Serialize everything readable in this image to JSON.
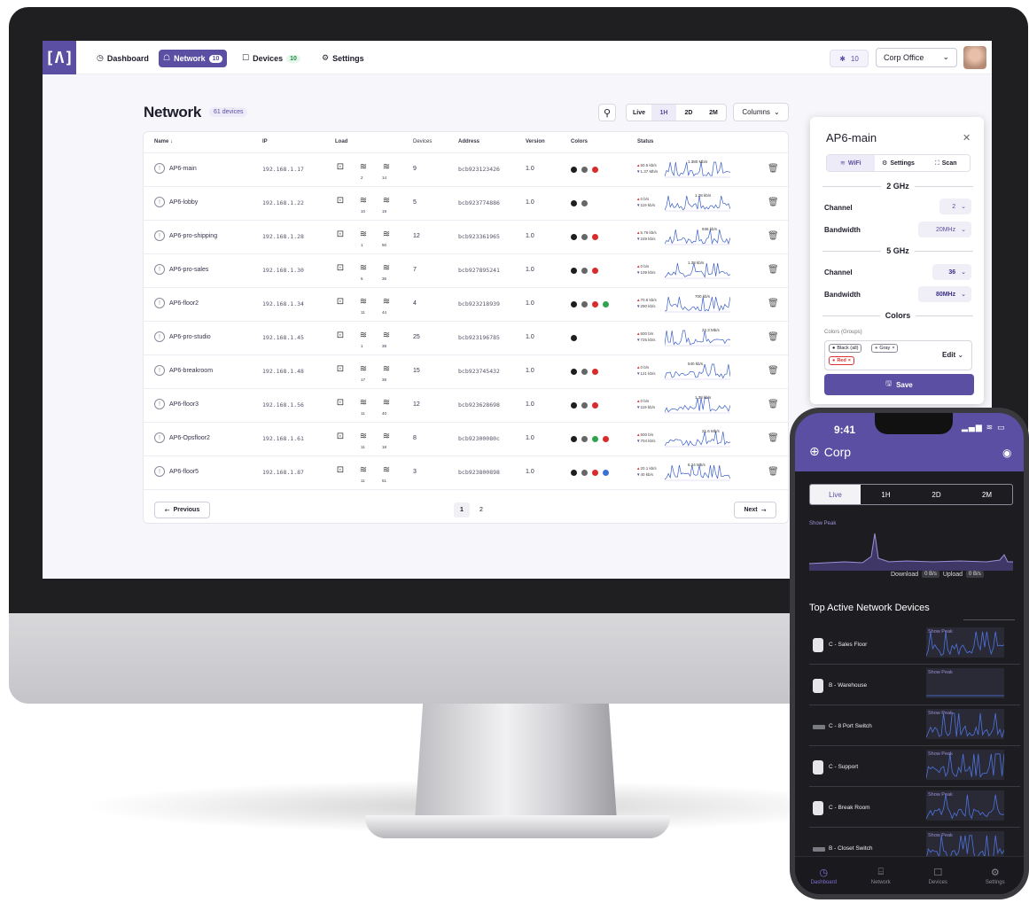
{
  "nav": {
    "logo": "[Λ]",
    "items": [
      {
        "label": "Dashboard",
        "icon": "◷",
        "badge": null,
        "active": false
      },
      {
        "label": "Network",
        "icon": "☖",
        "badge": "10",
        "active": true
      },
      {
        "label": "Devices",
        "icon": "☐",
        "badge": "10",
        "active": false
      },
      {
        "label": "Settings",
        "icon": "⚙",
        "badge": null,
        "active": false
      }
    ],
    "notifications_count": "10",
    "site": "Corp Office"
  },
  "page": {
    "title": "Network",
    "device_count": "61 devices",
    "ranges": [
      "Live",
      "1H",
      "2D",
      "2M"
    ],
    "active_range": "1H",
    "columns_label": "Columns"
  },
  "table": {
    "headers": {
      "name": "Name ↓",
      "ip": "IP",
      "load": "Load",
      "devices": "Devices",
      "address": "Address",
      "version": "Version",
      "colors": "Colors",
      "status": "Status"
    },
    "rows": [
      {
        "name": "AP6-main",
        "ip": "192.168.1.17",
        "devices": "9",
        "address": "bcb923123426",
        "version": "1.0",
        "colors": [
          "#1e1e1e",
          "#666666",
          "#d92b2b"
        ],
        "up": "50.5 kb/s",
        "down": "1.37 Mb/s",
        "peak": "1.380 Mb/s",
        "load2": "2",
        "load3": "14"
      },
      {
        "name": "AP6-lobby",
        "ip": "192.168.1.22",
        "devices": "5",
        "address": "bcb923774886",
        "version": "1.0",
        "colors": [
          "#1e1e1e",
          "#666666"
        ],
        "up": "0 b/s",
        "down": "119 kb/s",
        "peak": "1.28 kb/s",
        "load2": "10",
        "load3": "19"
      },
      {
        "name": "AP6-pro-shipping",
        "ip": "192.168.1.28",
        "devices": "12",
        "address": "bcb923361965",
        "version": "1.0",
        "colors": [
          "#1e1e1e",
          "#666666",
          "#d92b2b"
        ],
        "up": "5.76 kb/s",
        "down": "249 kb/s",
        "peak": "936 kb/s",
        "load2": "1",
        "load3": "50"
      },
      {
        "name": "AP6-pro-sales",
        "ip": "192.168.1.30",
        "devices": "7",
        "address": "bcb927895241",
        "version": "1.0",
        "colors": [
          "#1e1e1e",
          "#666666",
          "#d92b2b"
        ],
        "up": "0 b/s",
        "down": "109 kb/s",
        "peak": "1.38 kb/s",
        "load2": "5",
        "load3": "36"
      },
      {
        "name": "AP6-floor2",
        "ip": "192.168.1.34",
        "devices": "4",
        "address": "bcb923218939",
        "version": "1.0",
        "colors": [
          "#1e1e1e",
          "#666666",
          "#d92b2b",
          "#2ea44f"
        ],
        "up": "70.6 kb/s",
        "down": "290 kb/s",
        "peak": "700 kb/s",
        "load2": "11",
        "load3": "44"
      },
      {
        "name": "AP6-pro-studio",
        "ip": "192.168.1.45",
        "devices": "25",
        "address": "bcb923196785",
        "version": "1.0",
        "colors": [
          "#1e1e1e"
        ],
        "up": "600 b/s",
        "down": "725 kb/s",
        "peak": "22.3 Mb/s",
        "load2": "1",
        "load3": "38"
      },
      {
        "name": "AP6-breakroom",
        "ip": "192.168.1.48",
        "devices": "15",
        "address": "bcb923745432",
        "version": "1.0",
        "colors": [
          "#1e1e1e",
          "#666666",
          "#d92b2b"
        ],
        "up": "0 b/s",
        "down": "121 kb/s",
        "peak": "540 kb/s",
        "load2": "17",
        "load3": "38"
      },
      {
        "name": "AP6-floor3",
        "ip": "192.168.1.56",
        "devices": "12",
        "address": "bcb923628698",
        "version": "1.0",
        "colors": [
          "#1e1e1e",
          "#666666",
          "#d92b2b"
        ],
        "up": "0 b/s",
        "down": "119 kb/s",
        "peak": "1.38 kb/s",
        "load2": "11",
        "load3": "40"
      },
      {
        "name": "AP6-Opsfloor2",
        "ip": "192.168.1.61",
        "devices": "8",
        "address": "bcb92300080c",
        "version": "1.0",
        "colors": [
          "#1e1e1e",
          "#666666",
          "#2ea44f",
          "#d92b2b"
        ],
        "up": "500 b/s",
        "down": "704 kb/s",
        "peak": "21.6 Mb/s",
        "load2": "11",
        "load3": "18"
      },
      {
        "name": "AP6-floor5",
        "ip": "192.168.1.87",
        "devices": "3",
        "address": "bcb923800898",
        "version": "1.0",
        "colors": [
          "#1e1e1e",
          "#666666",
          "#d92b2b",
          "#3b6fd9"
        ],
        "up": "20.1 kb/s",
        "down": "40 kb/s",
        "peak": "6.24 Mb/s",
        "load2": "11",
        "load3": "51"
      }
    ],
    "prev_label": "Previous",
    "next_label": "Next",
    "pages": [
      "1",
      "2"
    ]
  },
  "panel": {
    "title": "AP6-main",
    "tabs": [
      "WiFi",
      "Settings",
      "Scan"
    ],
    "band1": "2 GHz",
    "band1_channel": "2",
    "band1_bandwidth": "20MHz",
    "band2": "5 GHz",
    "band2_channel": "36",
    "band2_bandwidth": "80MHz",
    "channel_label": "Channel",
    "bandwidth_label": "Bandwidth",
    "colors_section": "Colors",
    "colors_label": "Colors (Groups)",
    "chips": [
      "Black (all)",
      "Gray",
      "Red"
    ],
    "edit_label": "Edit",
    "save_label": "Save"
  },
  "phone": {
    "time": "9:41",
    "org": "Corp",
    "ranges": [
      "Live",
      "1H",
      "2D",
      "2M"
    ],
    "show_peak": "Show Peak",
    "download_label": "Download",
    "download_value": "0 B/s",
    "upload_label": "Upload",
    "upload_value": "0 B/s",
    "top_devices_title": "Top Active Network Devices",
    "devices": [
      {
        "name": "C - Sales Floor",
        "kind": "device"
      },
      {
        "name": "B - Warehouse",
        "kind": "device"
      },
      {
        "name": "C - 8 Port Switch",
        "kind": "switch"
      },
      {
        "name": "C - Support",
        "kind": "device"
      },
      {
        "name": "C - Break Room",
        "kind": "device"
      },
      {
        "name": "B - Closet Switch",
        "kind": "switch"
      }
    ],
    "nav": [
      "Dashboard",
      "Network",
      "Devices",
      "Settings"
    ]
  }
}
